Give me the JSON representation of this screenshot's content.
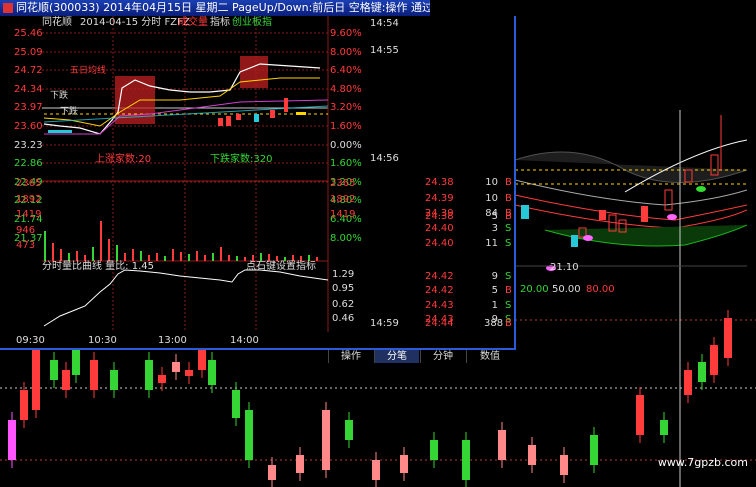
{
  "window": {
    "title": "同花顺(300033)  2014年04月15日 星期二 PageUp/Down:前后日 空格键:操作 通过"
  },
  "chart_header": {
    "app_label": "同花顺",
    "date_label": "2014-04-15 分时 FZFZ",
    "items": [
      "成交量",
      "指标",
      "创业板指"
    ]
  },
  "price_axis_left": [
    "25.46",
    "25.09",
    "24.72",
    "24.34",
    "23.97",
    "23.60",
    "23.23",
    "22.86",
    "22.49",
    "22.12",
    "21.74",
    "21.37"
  ],
  "pct_axis_right": [
    "9.60%",
    "8.00%",
    "6.40%",
    "4.80%",
    "3.20%",
    "1.60%",
    "0.00%",
    "1.60%",
    "3.20%",
    "4.80%",
    "6.40%",
    "8.00%"
  ],
  "volume_axis": [
    "2365",
    "1892",
    "1419",
    "946",
    "473"
  ],
  "volume_axis_right": [
    "2365",
    "1892",
    "1419"
  ],
  "up_count": "上涨家数:20",
  "down_count": "下跌家数:320",
  "trend_labels": [
    "五日均线",
    "下跌",
    "下跌"
  ],
  "ratio_panel": {
    "title": "分时量比曲线  量比: 1.45",
    "hint": "点石键设置指标",
    "axis": [
      "1.29",
      "0.95",
      "0.62",
      "0.46"
    ]
  },
  "time_axis": [
    "09:30",
    "10:30",
    "13:00",
    "14:00"
  ],
  "tabs": [
    "操作",
    "分笔",
    "分钟",
    "数值"
  ],
  "tabs_active_index": 1,
  "ticks": [
    {
      "time": "14:54",
      "price": "",
      "vol": ""
    },
    {
      "time": "14:55",
      "price": "",
      "vol": ""
    },
    {
      "time": "14:56",
      "price": "24.38",
      "vol": "5"
    },
    {
      "time": "",
      "price": "24.38",
      "vol": "10"
    },
    {
      "time": "",
      "price": "24.39",
      "vol": "10"
    },
    {
      "time": "",
      "price": "24.39",
      "vol": "84"
    },
    {
      "time": "",
      "price": "24.40",
      "vol": "3"
    },
    {
      "time": "",
      "price": "24.40",
      "vol": "11"
    },
    {
      "time": "",
      "price": "24.42",
      "vol": "9"
    },
    {
      "time": "",
      "price": "24.42",
      "vol": "5"
    },
    {
      "time": "",
      "price": "24.43",
      "vol": "1"
    },
    {
      "time": "",
      "price": "24.43",
      "vol": "9"
    },
    {
      "time": "14:59",
      "price": "24.44",
      "vol": "388"
    }
  ],
  "tick_flags": [
    "S",
    "B",
    "B",
    "B",
    "B",
    "B",
    "S",
    "S",
    "S",
    "B",
    "S",
    "S",
    "B"
  ],
  "kline_annot": {
    "low_mark": "21.10",
    "ma_labels": [
      "20.00",
      "50.00",
      "80.00"
    ]
  },
  "watermark": "www.7gpzb.com",
  "colors": {
    "up": "#ff3b3b",
    "down": "#35d535",
    "title_bar": "#0a1e7a",
    "border": "#2a5bd8"
  }
}
